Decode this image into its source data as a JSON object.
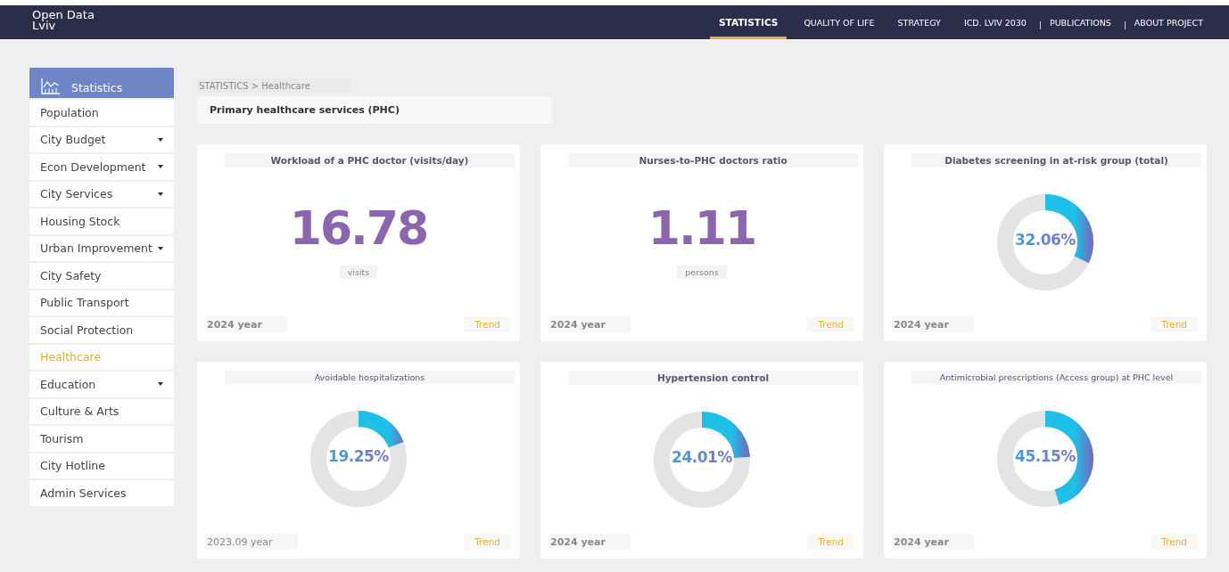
{
  "brand": "Open Data\nLviv",
  "nav": [
    {
      "label": "STATISTICS",
      "selected": true
    },
    {
      "label": "QUALITY OF LIFE",
      "selected": false
    },
    {
      "label": "STRATEGY",
      "selected": false
    },
    {
      "label": "ICD. LVIV 2030",
      "selected": false
    },
    {
      "label": "PUBLICATIONS",
      "selected": false
    },
    {
      "label": "ABOUT PROJECT",
      "selected": false
    }
  ],
  "sidebar": {
    "header": "Statistics",
    "items": [
      {
        "label": "Population",
        "selected": false,
        "has_submenu": false
      },
      {
        "label": "City Budget",
        "selected": false,
        "has_submenu": true
      },
      {
        "label": "Econ Development",
        "selected": false,
        "has_submenu": true
      },
      {
        "label": "City Services",
        "selected": false,
        "has_submenu": true
      },
      {
        "label": "Housing Stock",
        "selected": false,
        "has_submenu": false
      },
      {
        "label": "Urban Improvement",
        "selected": false,
        "has_submenu": true
      },
      {
        "label": "City Safety",
        "selected": false,
        "has_submenu": false
      },
      {
        "label": "Public Transport",
        "selected": false,
        "has_submenu": false
      },
      {
        "label": "Social Protection",
        "selected": false,
        "has_submenu": false
      },
      {
        "label": "Healthcare",
        "selected": true,
        "has_submenu": false
      },
      {
        "label": "Education",
        "selected": false,
        "has_submenu": true
      },
      {
        "label": "Culture & Arts",
        "selected": false,
        "has_submenu": false
      },
      {
        "label": "Tourism",
        "selected": false,
        "has_submenu": false
      },
      {
        "label": "City Hotline",
        "selected": false,
        "has_submenu": false
      },
      {
        "label": "Admin Services",
        "selected": false,
        "has_submenu": false
      }
    ]
  },
  "breadcrumb": "STATISTICS > Healthcare",
  "section_title": "Primary healthcare services (PHC)",
  "cards": [
    {
      "kind": "number",
      "title": "Workload of a PHC doctor (visits/day)",
      "title_bold": true,
      "value": "16.78",
      "unit": "visits",
      "year": "2024 year",
      "year_bold": true,
      "trend": "Trend"
    },
    {
      "kind": "number",
      "title": "Nurses-to-PHC doctors ratio",
      "title_bold": true,
      "value": "1.11",
      "unit": "persons",
      "year": "2024 year",
      "year_bold": true,
      "trend": "Trend"
    },
    {
      "kind": "donut",
      "title": "Diabetes screening in at-risk group (total)",
      "title_bold": true,
      "value": "32.06%",
      "level": 0.3206,
      "year": "2024 year",
      "year_bold": true,
      "trend": "Trend"
    },
    {
      "kind": "donut",
      "title": "Avoidable hospitalizations",
      "title_bold": false,
      "value": "19.25%",
      "level": 0.1925,
      "year": "2023.09 year",
      "year_bold": false,
      "trend": "Trend"
    },
    {
      "kind": "donut",
      "title": "Hypertension control",
      "title_bold": true,
      "value": "24.01%",
      "level": 0.2401,
      "year": "2024 year",
      "year_bold": true,
      "trend": "Trend"
    },
    {
      "kind": "donut",
      "title": "Antimicrobial prescriptions (Access group) at PHC level",
      "title_bold": false,
      "value": "45.15%",
      "level": 0.4515,
      "year": "2024 year",
      "year_bold": true,
      "trend": "Trend"
    }
  ]
}
